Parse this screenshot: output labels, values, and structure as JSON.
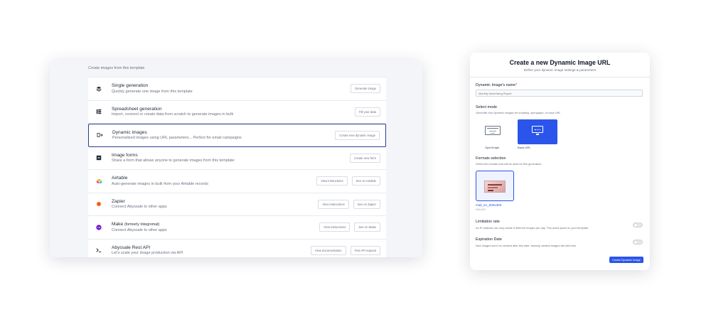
{
  "left": {
    "heading": "Create images from this template",
    "items": [
      {
        "icon": "layers-icon",
        "title": "Single generation",
        "subtitle": "",
        "desc": "Quickly generate one image from this template",
        "buttons": [
          "Generate image"
        ]
      },
      {
        "icon": "spreadsheet-icon",
        "title": "Spreadsheet generation",
        "subtitle": "",
        "desc": "Import, connect or create data from scratch to generate images in bulk",
        "buttons": [
          "Fill your data"
        ]
      },
      {
        "icon": "dynamic-image-icon",
        "title": "Dynamic images",
        "subtitle": "",
        "desc": "Personalized images using URL parameters... Perfect for email campaigns",
        "buttons": [
          "Create new dynamic image"
        ]
      },
      {
        "icon": "form-icon",
        "title": "Image forms",
        "subtitle": "",
        "desc": "Share a form that allows anyone to generate images from this template",
        "buttons": [
          "Create new form"
        ]
      },
      {
        "icon": "airtable-icon",
        "title": "Airtable",
        "subtitle": "",
        "desc": "Auto-generate images in bulk from your Airtable records",
        "buttons": [
          "View instructions",
          "See on Airtable"
        ]
      },
      {
        "icon": "zapier-icon",
        "title": "Zapier",
        "subtitle": "",
        "desc": "Connect Abyssale to other apps",
        "buttons": [
          "View instructions",
          "See on Zapier"
        ]
      },
      {
        "icon": "make-icon",
        "title": "Make",
        "subtitle": "(formerly Integromat)",
        "desc": "Connect Abyssale to other apps",
        "buttons": [
          "View instructions",
          "See on Make"
        ]
      },
      {
        "icon": "terminal-icon",
        "title": "Abyssale Rest API",
        "subtitle": "",
        "desc": "Let's scale your image production via API",
        "buttons": [
          "View documentation",
          "Test API request"
        ]
      }
    ]
  },
  "panel": {
    "title": "Create a new Dynamic Image URL",
    "subtitle": "Define your dynamic image settings & parameters",
    "name_label": "Dynamic Image's name",
    "name_required": "*",
    "name_placeholder": "Monthly Advertising Report",
    "mode_label": "Select mode",
    "mode_hint": "Generate new dynamic images for emailing, opengraph, or base URL",
    "modes": [
      {
        "label": "OpenGraph",
        "icon": "opengraph-icon",
        "selected": false
      },
      {
        "label": "Basic URL",
        "icon": "monitor-icon",
        "selected": true
      }
    ],
    "formats_label": "Formats selection",
    "formats_hint": "Select the formats that will be used for this generation",
    "format_name": "mail_en_600x300",
    "format_size": "600x300",
    "limitation_label": "Limitation rate",
    "limitation_hint": "An IP address can only create 5 different images per day. This avoid spam on your template.",
    "expiration_label": "Expiration Date",
    "expiration_hint": "New images won't be created after this date. Already created images will still exist.",
    "create_button": "Create Dynamic Image",
    "accent_color": "#2b55ea"
  }
}
